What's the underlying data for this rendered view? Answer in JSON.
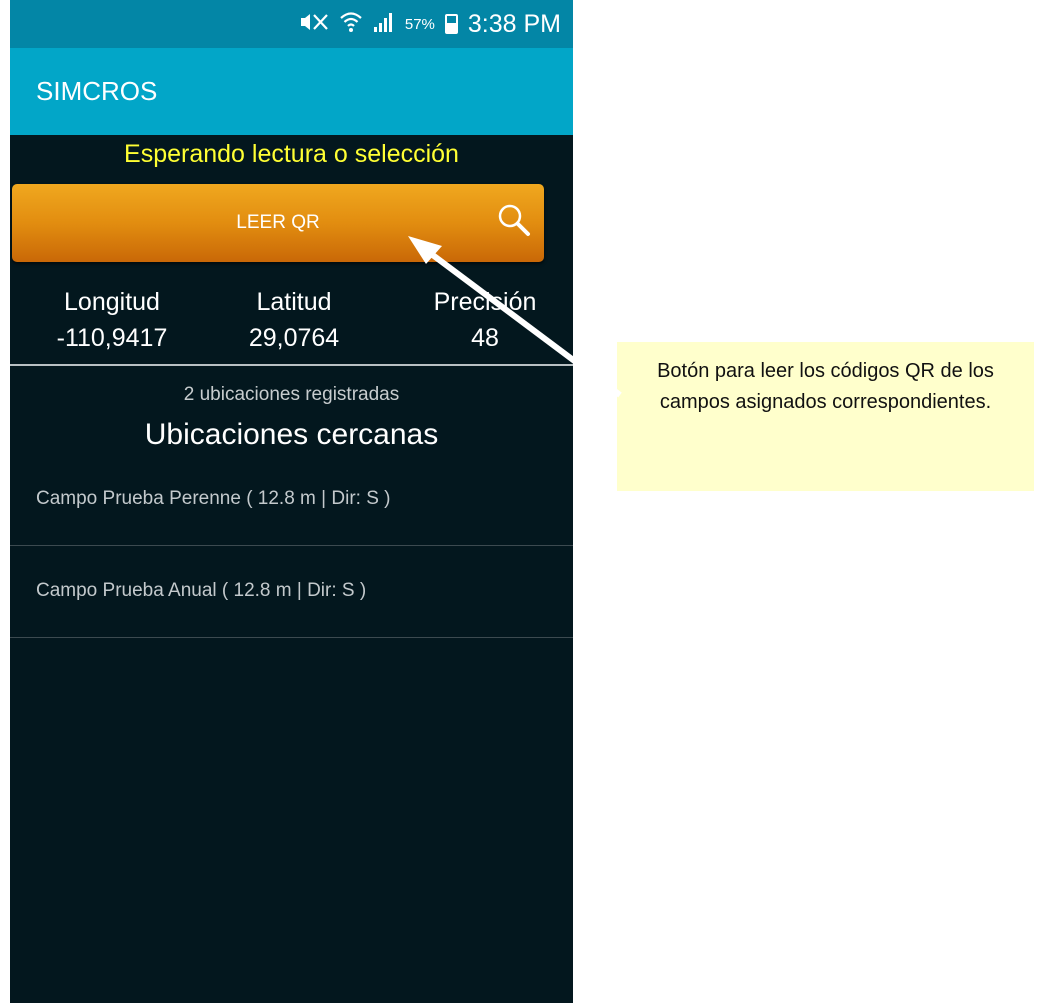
{
  "status_bar": {
    "signal_label": "57%",
    "time": "3:38 PM",
    "icons": [
      "mute-vibrate-icon",
      "wifi-icon",
      "cell-signal-icon",
      "battery-icon"
    ]
  },
  "app_bar": {
    "title": "SIMCROS"
  },
  "status_message": "Esperando lectura o selección",
  "qr_button": {
    "label": "LEER QR",
    "icon": "search-icon"
  },
  "coordinates": [
    {
      "label": "Longitud",
      "value": "-110,9417"
    },
    {
      "label": "Latitud",
      "value": "29,0764"
    },
    {
      "label": "Precisión",
      "value": "48"
    }
  ],
  "locations": {
    "count_label": "2 ubicaciones registradas",
    "title": "Ubicaciones cercanas",
    "items": [
      {
        "text": "Campo Prueba Perenne ( 12.8 m | Dir: S )"
      },
      {
        "text": "Campo Prueba Anual ( 12.8 m | Dir: S )"
      }
    ]
  },
  "callout": {
    "text": "Botón para leer los códigos QR de los campos asignados correspondientes."
  },
  "colors": {
    "status_bar": "#0386a6",
    "app_bar": "#02a6c8",
    "background": "#03171e",
    "status_message": "#ffff33",
    "button_orange": "#e28d10",
    "callout_bg": "#ffffcc"
  }
}
